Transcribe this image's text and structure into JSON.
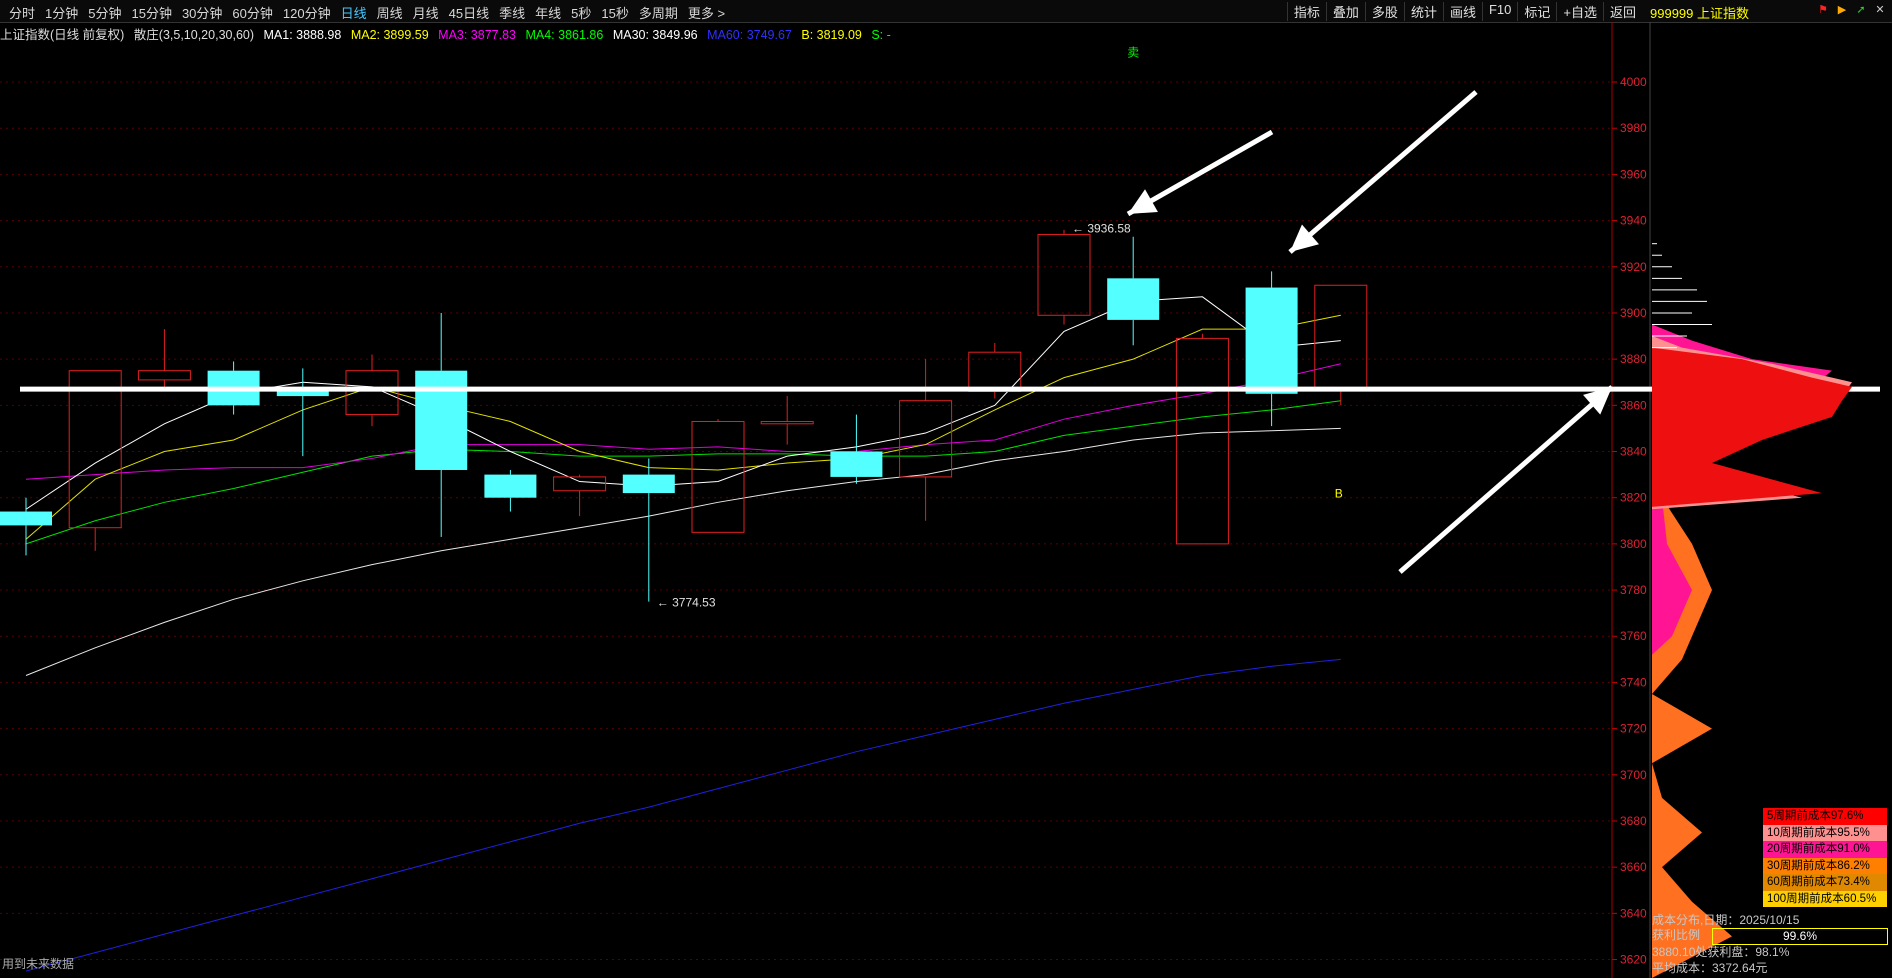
{
  "toolbar": {
    "periods": [
      "分时",
      "1分钟",
      "5分钟",
      "15分钟",
      "30分钟",
      "60分钟",
      "120分钟",
      "日线",
      "周线",
      "月线",
      "45日线",
      "季线",
      "年线",
      "5秒",
      "15秒",
      "多周期",
      "更多 >"
    ],
    "active_period": "日线",
    "tools": [
      "指标",
      "叠加",
      "多股",
      "统计",
      "画线",
      "F10",
      "标记",
      "+自选",
      "返回"
    ],
    "symbol": "999999 上证指数"
  },
  "ma_bar": {
    "title": "上证指数(日线 前复权)",
    "indicator": "散庄(3,5,10,20,30,60)",
    "ma1": "MA1: 3888.98",
    "ma2": "MA2: 3899.59",
    "ma3": "MA3: 3877.83",
    "ma4": "MA4: 3861.86",
    "ma30": "MA30: 3849.96",
    "ma60": "MA60: 3749.67",
    "b": "B: 3819.09",
    "s": "S: -",
    "colors": {
      "ma1": "#ffffff",
      "ma2": "#ffff00",
      "ma3": "#ff00ff",
      "ma4": "#00ff00",
      "ma30": "#ffffff",
      "ma60": "#3030ff",
      "b": "#ffff00",
      "s": "#00ff00"
    }
  },
  "chart_data": {
    "type": "candlestick",
    "ylim": [
      3612,
      4026
    ],
    "y_ticks": [
      3620,
      3640,
      3660,
      3680,
      3700,
      3720,
      3740,
      3760,
      3780,
      3800,
      3820,
      3840,
      3860,
      3880,
      3900,
      3920,
      3940,
      3960,
      3980,
      4000
    ],
    "candles": [
      {
        "o": 3814,
        "h": 3820,
        "l": 3795,
        "c": 3808
      },
      {
        "o": 3807,
        "h": 3875,
        "l": 3797,
        "c": 3875
      },
      {
        "o": 3871,
        "h": 3893,
        "l": 3868,
        "c": 3875
      },
      {
        "o": 3875,
        "h": 3879,
        "l": 3856,
        "c": 3860
      },
      {
        "o": 3867,
        "h": 3876,
        "l": 3838,
        "c": 3864
      },
      {
        "o": 3856,
        "h": 3882,
        "l": 3851,
        "c": 3875
      },
      {
        "o": 3875,
        "h": 3900,
        "l": 3803,
        "c": 3832
      },
      {
        "o": 3830,
        "h": 3832,
        "l": 3814,
        "c": 3820
      },
      {
        "o": 3823,
        "h": 3830,
        "l": 3812,
        "c": 3829
      },
      {
        "o": 3830,
        "h": 3837,
        "l": 3775,
        "c": 3822
      },
      {
        "o": 3805,
        "h": 3854,
        "l": 3805,
        "c": 3853
      },
      {
        "o": 3852,
        "h": 3864,
        "l": 3843,
        "c": 3853
      },
      {
        "o": 3840,
        "h": 3856,
        "l": 3826,
        "c": 3829
      },
      {
        "o": 3829,
        "h": 3880,
        "l": 3810,
        "c": 3862
      },
      {
        "o": 3866,
        "h": 3887,
        "l": 3863,
        "c": 3883
      },
      {
        "o": 3899,
        "h": 3936,
        "l": 3895,
        "c": 3934
      },
      {
        "o": 3915,
        "h": 3933,
        "l": 3886,
        "c": 3897
      },
      {
        "o": 3800,
        "h": 3891,
        "l": 3800,
        "c": 3889
      },
      {
        "o": 3911,
        "h": 3918,
        "l": 3851,
        "c": 3865
      },
      {
        "o": 3867,
        "h": 3912,
        "l": 3860,
        "c": 3912
      }
    ],
    "annotations": [
      {
        "label": "3936.58",
        "x_index": 15,
        "y": 3936.58
      },
      {
        "label": "3774.53",
        "x_index": 9,
        "y": 3774.53
      }
    ],
    "ma1": [
      3815,
      3835,
      3852,
      3865,
      3870,
      3868,
      3855,
      3840,
      3827,
      3825,
      3827,
      3838,
      3842,
      3848,
      3860,
      3892,
      3905,
      3907,
      3885,
      3888
    ],
    "ma2": [
      3802,
      3828,
      3840,
      3845,
      3858,
      3868,
      3860,
      3853,
      3840,
      3833,
      3832,
      3835,
      3837,
      3843,
      3858,
      3872,
      3880,
      3893,
      3893,
      3899
    ],
    "ma3": [
      3828,
      3830,
      3832,
      3833,
      3833,
      3837,
      3843,
      3843,
      3843,
      3841,
      3842,
      3840,
      3840,
      3843,
      3845,
      3854,
      3860,
      3865,
      3871,
      3878
    ],
    "ma4": [
      3800,
      3810,
      3818,
      3824,
      3831,
      3838,
      3841,
      3840,
      3838,
      3838,
      3839,
      3839,
      3838,
      3838,
      3840,
      3847,
      3851,
      3855,
      3858,
      3862
    ],
    "ma30": [
      3743,
      3755,
      3766,
      3776,
      3784,
      3791,
      3797,
      3802,
      3807,
      3812,
      3818,
      3823,
      3827,
      3830,
      3836,
      3840,
      3845,
      3848,
      3849,
      3850
    ],
    "ma60": [
      3615,
      3623,
      3631,
      3639,
      3647,
      3655,
      3663,
      3671,
      3679,
      3686,
      3694,
      3702,
      3710,
      3717,
      3724,
      3731,
      3737,
      3743,
      3747,
      3750
    ],
    "support_line": 3867,
    "signals": [
      {
        "label": "卖",
        "x_index": 16,
        "y": 4011,
        "color": "#00ff00"
      },
      {
        "label": "B",
        "x_index": 19,
        "y": 3820,
        "color": "#ffff00"
      }
    ]
  },
  "cost_panel": {
    "title": "成本分布,日期：2025/10/15",
    "profit_label": "获利比例",
    "profit_value": "99.6%",
    "line1": "3880.10处获利盘：98.1%",
    "line2": "平均成本：3372.64元",
    "legend": [
      {
        "label": "5周期前成本97.6%",
        "color": "#ff0000"
      },
      {
        "label": "10周期前成本95.5%",
        "color": "#ff9090"
      },
      {
        "label": "20周期前成本91.0%",
        "color": "#ff1493"
      },
      {
        "label": "30周期前成本86.2%",
        "color": "#ff7f00"
      },
      {
        "label": "60周期前成本73.4%",
        "color": "#e08800"
      },
      {
        "label": "100周期前成本60.5%",
        "color": "#ffd000"
      }
    ]
  },
  "footer": {
    "text": "用到未来数据"
  }
}
